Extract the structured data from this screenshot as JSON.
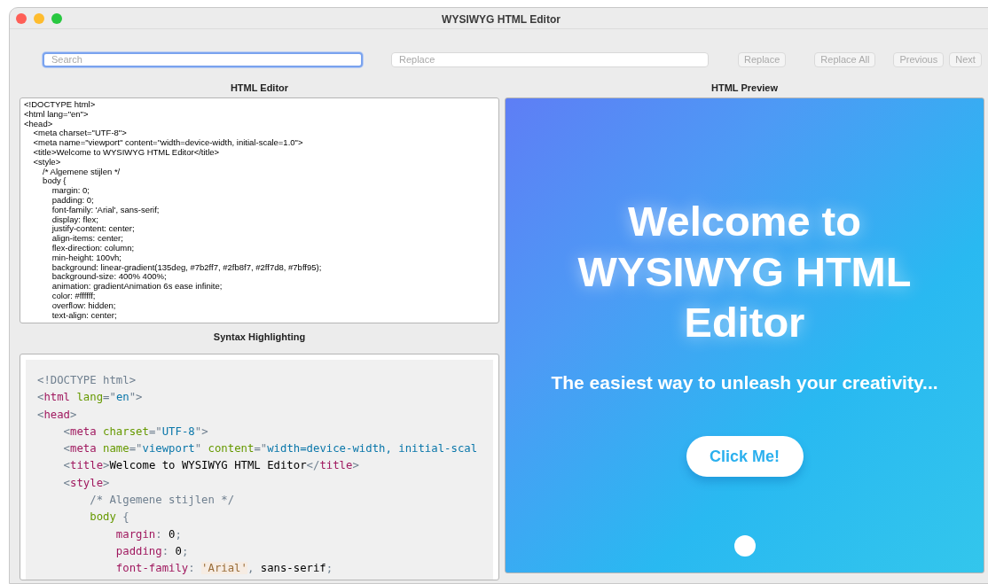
{
  "window": {
    "title": "WYSIWYG HTML Editor"
  },
  "toolbar": {
    "search": {
      "placeholder": "Search",
      "focused": true
    },
    "replace": {
      "placeholder": "Replace",
      "focused": false
    },
    "buttons": [
      {
        "label": "Replace",
        "disabled": true
      },
      {
        "label": "Replace All",
        "disabled": true
      },
      {
        "label": "Previous",
        "disabled": true
      },
      {
        "label": "Next",
        "disabled": true
      }
    ]
  },
  "editor": {
    "heading": "HTML Editor",
    "lines": [
      "<!DOCTYPE html>",
      "<html lang=\"en\">",
      "<head>",
      "    <meta charset=\"UTF-8\">",
      "    <meta name=\"viewport\" content=\"width=device-width, initial-scale=1.0\">",
      "    <title>Welcome to WYSIWYG HTML Editor</title>",
      "    <style>",
      "        /* Algemene stijlen */",
      "        body {",
      "            margin: 0;",
      "            padding: 0;",
      "            font-family: 'Arial', sans-serif;",
      "            display: flex;",
      "            justify-content: center;",
      "            align-items: center;",
      "            flex-direction: column;",
      "            min-height: 100vh;",
      "            background: linear-gradient(135deg, #7b2ff7, #2fb8f7, #2ff7d8, #7bff95);",
      "            background-size: 400% 400%;",
      "            animation: gradientAnimation 6s ease infinite;",
      "            color: #ffffff;",
      "            overflow: hidden;",
      "            text-align: center;"
    ]
  },
  "highlight": {
    "heading": "Syntax Highlighting",
    "lines": [
      [
        {
          "kind": "punct",
          "text": "<!DOCTYPE html>"
        }
      ],
      [
        {
          "kind": "punct",
          "text": "<"
        },
        {
          "kind": "tag",
          "text": "html"
        },
        {
          "kind": "attr",
          "text": " lang"
        },
        {
          "kind": "punct",
          "text": "=\""
        },
        {
          "kind": "value",
          "text": "en"
        },
        {
          "kind": "punct",
          "text": "\">"
        }
      ],
      [
        {
          "kind": "punct",
          "text": "<"
        },
        {
          "kind": "tag",
          "text": "head"
        },
        {
          "kind": "punct",
          "text": ">"
        }
      ],
      [
        {
          "kind": "punct",
          "text": "    <"
        },
        {
          "kind": "tag",
          "text": "meta"
        },
        {
          "kind": "attr",
          "text": " charset"
        },
        {
          "kind": "punct",
          "text": "=\""
        },
        {
          "kind": "value",
          "text": "UTF-8"
        },
        {
          "kind": "punct",
          "text": "\">"
        }
      ],
      [
        {
          "kind": "punct",
          "text": "    <"
        },
        {
          "kind": "tag",
          "text": "meta"
        },
        {
          "kind": "attr",
          "text": " name"
        },
        {
          "kind": "punct",
          "text": "=\""
        },
        {
          "kind": "value",
          "text": "viewport"
        },
        {
          "kind": "punct",
          "text": "\" "
        },
        {
          "kind": "attr",
          "text": "content"
        },
        {
          "kind": "punct",
          "text": "=\""
        },
        {
          "kind": "value",
          "text": "width=device-width, initial-scal"
        }
      ],
      [
        {
          "kind": "punct",
          "text": "    <"
        },
        {
          "kind": "tag",
          "text": "title"
        },
        {
          "kind": "punct",
          "text": ">"
        },
        {
          "kind": "plain",
          "text": "Welcome to WYSIWYG HTML Editor"
        },
        {
          "kind": "punct",
          "text": "</"
        },
        {
          "kind": "tag",
          "text": "title"
        },
        {
          "kind": "punct",
          "text": ">"
        }
      ],
      [
        {
          "kind": "punct",
          "text": "    <"
        },
        {
          "kind": "tag",
          "text": "style"
        },
        {
          "kind": "punct",
          "text": ">"
        }
      ],
      [
        {
          "kind": "comment",
          "text": "        /* Algemene stijlen */"
        }
      ],
      [
        {
          "kind": "selector",
          "text": "        body"
        },
        {
          "kind": "punct",
          "text": " {"
        }
      ],
      [
        {
          "kind": "prop",
          "text": "            margin"
        },
        {
          "kind": "punct",
          "text": ": "
        },
        {
          "kind": "plain",
          "text": "0"
        },
        {
          "kind": "punct",
          "text": ";"
        }
      ],
      [
        {
          "kind": "prop",
          "text": "            padding"
        },
        {
          "kind": "punct",
          "text": ": "
        },
        {
          "kind": "plain",
          "text": "0"
        },
        {
          "kind": "punct",
          "text": ";"
        }
      ],
      [
        {
          "kind": "prop",
          "text": "            font-family"
        },
        {
          "kind": "punct",
          "text": ": "
        },
        {
          "kind": "string",
          "text": "'Arial'"
        },
        {
          "kind": "punct",
          "text": ", "
        },
        {
          "kind": "plain",
          "text": "sans-serif"
        },
        {
          "kind": "punct",
          "text": ";"
        }
      ]
    ]
  },
  "preview": {
    "heading": "HTML Preview",
    "title": "Welcome to WYSIWYG HTML Editor",
    "subtitle": "The easiest way to unleash your creativity...",
    "button": "Click Me!"
  }
}
